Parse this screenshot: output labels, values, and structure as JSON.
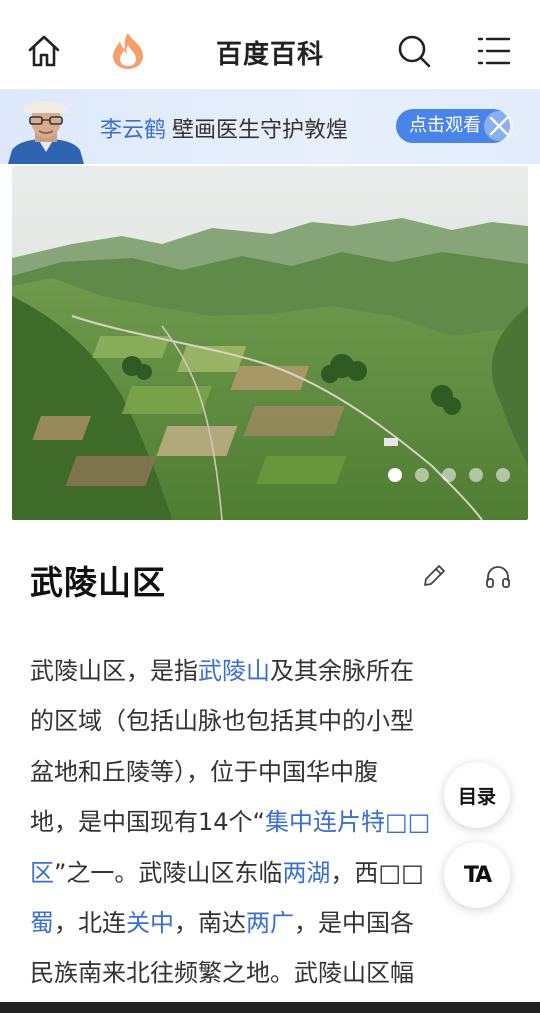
{
  "topbar": {
    "title": "百度百科"
  },
  "banner": {
    "name": "李云鹤",
    "text": "壁画医生守护敦煌",
    "button": "点击观看"
  },
  "hero": {
    "slide_count": 5,
    "active_slide": 1
  },
  "article": {
    "title": "武陵山区",
    "lines": [
      [
        {
          "t": "武陵山区，是指"
        },
        {
          "t": "武陵山",
          "link": true
        },
        {
          "t": "及其余脉所在"
        }
      ],
      [
        {
          "t": "的区域（包括山脉也包括其中的小型"
        }
      ],
      [
        {
          "t": "盆地和丘陵等），位于中国华中腹"
        }
      ],
      [
        {
          "t": "地，是中国现有14个“"
        },
        {
          "t": "集中连片特□□",
          "link": true
        }
      ],
      [
        {
          "t": "区",
          "link": true
        },
        {
          "t": "”之一。武陵山区东临"
        },
        {
          "t": "两湖",
          "link": true
        },
        {
          "t": "，西□□"
        }
      ],
      [
        {
          "t": "蜀",
          "link": true
        },
        {
          "t": "，北连"
        },
        {
          "t": "关中",
          "link": true
        },
        {
          "t": "，南达"
        },
        {
          "t": "两广",
          "link": true
        },
        {
          "t": "，是中国各"
        }
      ],
      [
        {
          "t": "民族南来北往频繁之地。武陵山区幅"
        }
      ]
    ]
  },
  "float": {
    "toc": "目录",
    "font": "TA"
  },
  "colors": {
    "link": "#3a6fd0",
    "accent": "#4a84e8",
    "logo": "#f47a3a"
  }
}
